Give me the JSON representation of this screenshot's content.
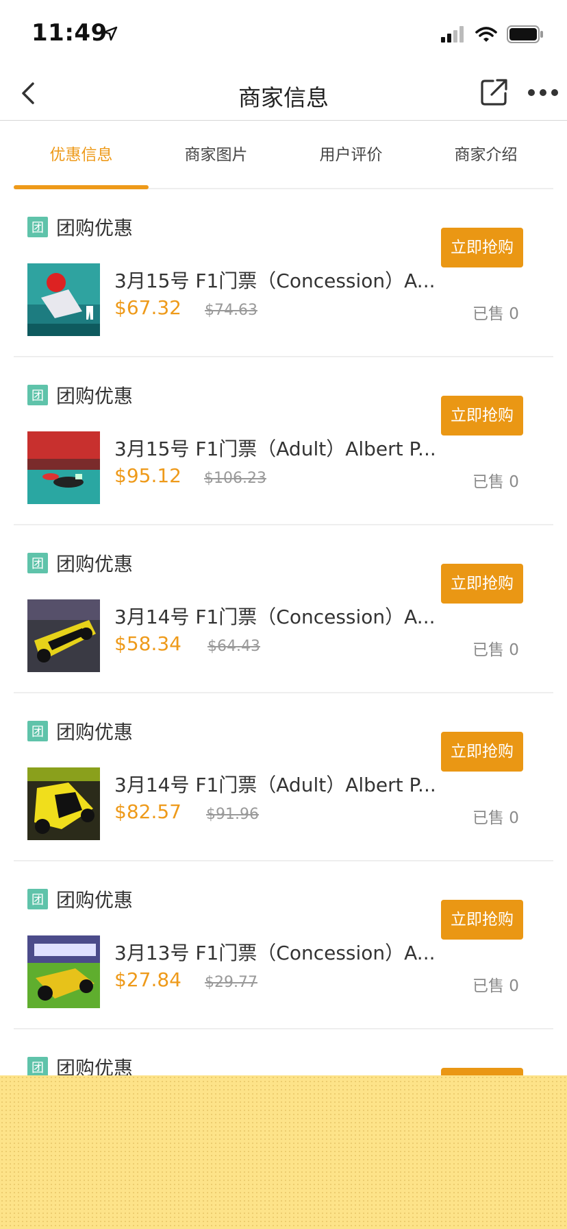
{
  "status_bar": {
    "time": "11:49"
  },
  "nav": {
    "title": "商家信息"
  },
  "tabs": [
    {
      "label": "优惠信息",
      "active": true
    },
    {
      "label": "商家图片",
      "active": false
    },
    {
      "label": "用户评价",
      "active": false
    },
    {
      "label": "商家介绍",
      "active": false
    }
  ],
  "deals": [
    {
      "tag_icon": "团",
      "tag": "团购优惠",
      "title": "3月15号 F1门票（Concession）A...",
      "price": "$67.32",
      "original_price": "$74.63",
      "button": "立即抢购",
      "sold": "已售 0"
    },
    {
      "tag_icon": "团",
      "tag": "团购优惠",
      "title": "3月15号 F1门票（Adult）Albert P...",
      "price": "$95.12",
      "original_price": "$106.23",
      "button": "立即抢购",
      "sold": "已售 0"
    },
    {
      "tag_icon": "团",
      "tag": "团购优惠",
      "title": "3月14号 F1门票（Concession）A...",
      "price": "$58.34",
      "original_price": "$64.43",
      "button": "立即抢购",
      "sold": "已售 0"
    },
    {
      "tag_icon": "团",
      "tag": "团购优惠",
      "title": "3月14号 F1门票（Adult）Albert P...",
      "price": "$82.57",
      "original_price": "$91.96",
      "button": "立即抢购",
      "sold": "已售 0"
    },
    {
      "tag_icon": "团",
      "tag": "团购优惠",
      "title": "3月13号 F1门票（Concession）A...",
      "price": "$27.84",
      "original_price": "$29.77",
      "button": "立即抢购",
      "sold": "已售 0"
    },
    {
      "tag_icon": "团",
      "tag": "团购优惠",
      "title": "",
      "price": "",
      "original_price": "",
      "button": "",
      "sold": ""
    }
  ],
  "colors": {
    "accent": "#ea9714",
    "tag_green": "#5fc3aa",
    "overlay_yellow": "#fde389"
  }
}
